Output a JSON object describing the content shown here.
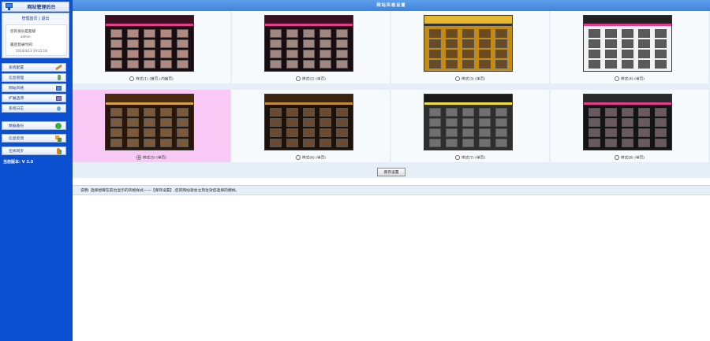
{
  "sidebar": {
    "title": "网站管理后台",
    "user_links": {
      "home": "管理首页",
      "separator": "|",
      "logout": "退出"
    },
    "user_info": {
      "line1": "您的身份是超级",
      "line1_sub": "admin",
      "line2": "最后登录时间:",
      "line2_sub": "2014/4/13 19:22:18"
    },
    "menu_group1": [
      {
        "label": "系统配置",
        "icon": "wrench-icon"
      },
      {
        "label": "信息管理",
        "icon": "pencil-icon"
      },
      {
        "label": "网站风格",
        "icon": "monitor-icon"
      },
      {
        "label": "扩展选项",
        "icon": "puzzle-icon"
      },
      {
        "label": "系统日志",
        "icon": "log-icon"
      }
    ],
    "menu_group2": [
      {
        "label": "数据备份",
        "icon": "backup-icon"
      },
      {
        "label": "信息反馈",
        "icon": "feedback-icon"
      },
      {
        "label": "在线同步",
        "icon": "sync-icon"
      }
    ],
    "version": "当前版本: V 3.0"
  },
  "main": {
    "header_title": "网站风格设置",
    "styles": [
      {
        "label": "样式(1) (首页+内容页)",
        "selected": false,
        "theme": "pinkgrid"
      },
      {
        "label": "样式(2) (单页)",
        "selected": false,
        "theme": "pinkgrid2"
      },
      {
        "label": "样式(3) (单页)",
        "selected": false,
        "theme": "yellow"
      },
      {
        "label": "样式(4) (单页)",
        "selected": false,
        "theme": "white"
      },
      {
        "label": "样式(5) (单页)",
        "selected": true,
        "theme": "brown"
      },
      {
        "label": "样式(6) (单页)",
        "selected": false,
        "theme": "darkbrown"
      },
      {
        "label": "样式(7) (单页)",
        "selected": false,
        "theme": "gray"
      },
      {
        "label": "样式(8) (单页)",
        "selected": false,
        "theme": "dark"
      }
    ],
    "save_label": "保存设置",
    "note": "说明: 选择想要在前台显示的风格样式——【保存设置】,您的网站就会立刻生效您选择的模样。"
  },
  "colors": {
    "sidebar_bg": "#0a50d0",
    "header_bg": "#4a8fe4",
    "selected_bg": "#f9c9f5",
    "panel_bg": "#e6eff8"
  }
}
